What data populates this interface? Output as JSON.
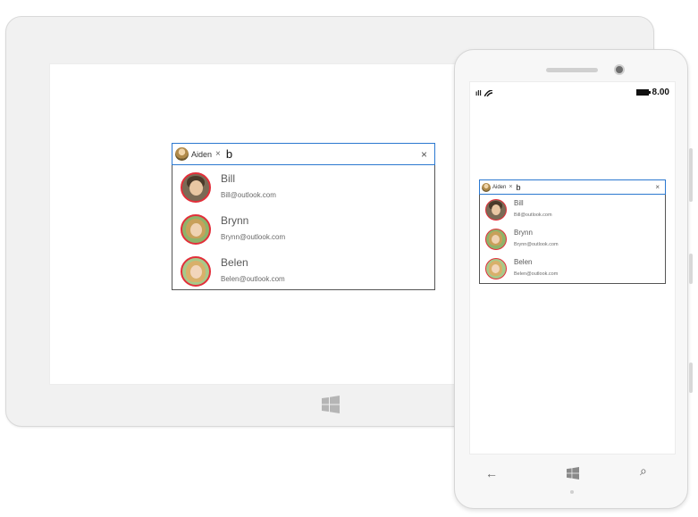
{
  "autocomplete": {
    "token": {
      "label": "Aiden",
      "close_glyph": "×"
    },
    "typed_text": "b",
    "clear_glyph": "×",
    "suggestions": [
      {
        "name": "Bill",
        "email": "Bill@outlook.com",
        "avatar_icon": "bill-avatar-icon"
      },
      {
        "name": "Brynn",
        "email": "Brynn@outlook.com",
        "avatar_icon": "brynn-avatar-icon"
      },
      {
        "name": "Belen",
        "email": "Belen@outlook.com",
        "avatar_icon": "belen-avatar-icon"
      }
    ],
    "colors": {
      "focus_border": "#2b78d0",
      "avatar_ring": "#e22f3a"
    }
  },
  "phone": {
    "status": {
      "signal": "ıll",
      "battery_time": "8.00"
    },
    "nav": {
      "back_glyph": "←",
      "search_glyph": "⌕"
    }
  }
}
